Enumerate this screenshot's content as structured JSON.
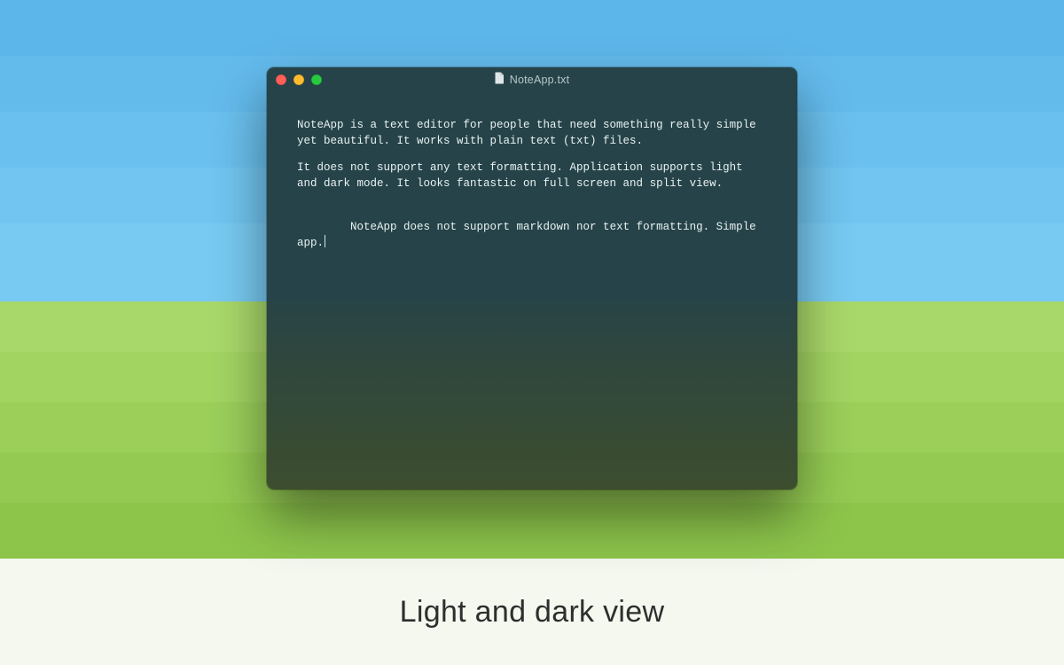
{
  "window": {
    "title": "NoteApp.txt",
    "icons": {
      "document": "document-icon"
    },
    "traffic_lights": {
      "close": "#ff5f57",
      "minimize": "#febc2e",
      "zoom": "#28c840"
    }
  },
  "editor": {
    "paragraphs": [
      "NoteApp is a text editor for people that need something really simple yet beautiful. It works with plain text (txt) files.",
      "It does not support any text formatting. Application supports light and dark mode. It looks fantastic on full screen and split view.",
      "NoteApp does not support markdown nor text formatting. Simple app."
    ]
  },
  "caption": "Light and dark view"
}
